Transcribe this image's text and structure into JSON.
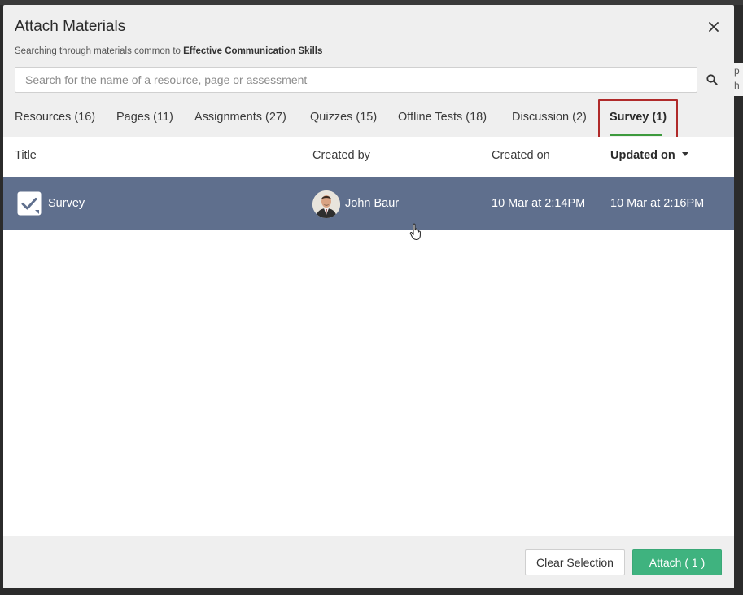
{
  "dialog": {
    "title": "Attach Materials",
    "subtitle_prefix": "Searching through materials common to",
    "course_name": "Effective Communication Skills"
  },
  "search": {
    "placeholder": "Search for the name of a resource, page or assessment",
    "value": ""
  },
  "tabs": [
    {
      "label": "Resources (16)"
    },
    {
      "label": "Pages (11)"
    },
    {
      "label": "Assignments (27)"
    },
    {
      "label": "Quizzes (15)"
    },
    {
      "label": "Offline Tests (18)"
    },
    {
      "label": "Discussion (2)"
    },
    {
      "label": "Survey (1)",
      "active": true
    }
  ],
  "table": {
    "columns": {
      "title": "Title",
      "created_by": "Created by",
      "created_on": "Created on",
      "updated_on": "Updated on"
    },
    "sort_column": "updated_on",
    "rows": [
      {
        "title": "Survey",
        "created_by": "John Baur",
        "created_on": "10 Mar at 2:14PM",
        "updated_on": "10 Mar at 2:16PM",
        "selected": true,
        "icon": "survey-check-icon"
      }
    ]
  },
  "footer": {
    "clear_label": "Clear Selection",
    "attach_label": "Attach ( 1 )"
  },
  "side_peek": {
    "line1": "p",
    "line2": "h"
  },
  "colors": {
    "selected_row": "#5f6f8d",
    "attach_button": "#3fb37f",
    "active_tab_underline": "#3d9a3d",
    "active_tab_outline": "#b02a2a"
  }
}
